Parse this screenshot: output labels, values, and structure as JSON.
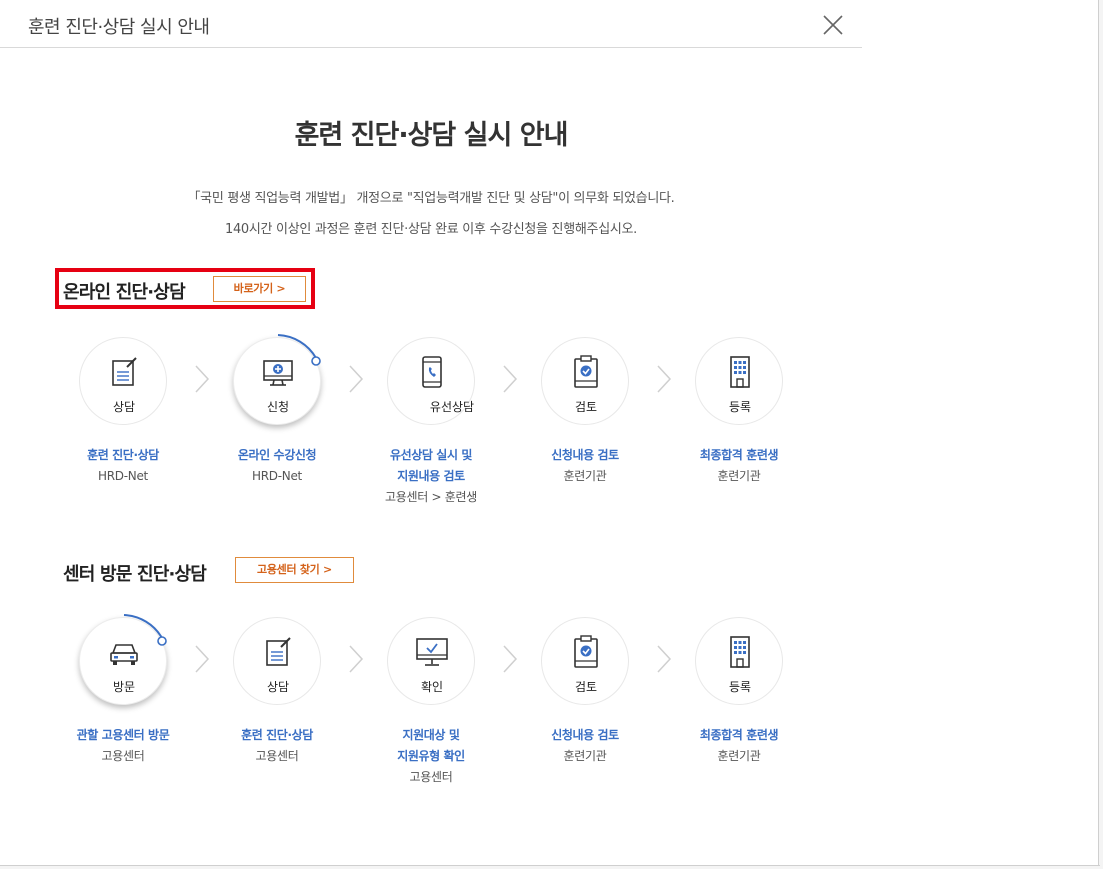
{
  "header": {
    "title": "훈련 진단·상담 실시 안내"
  },
  "main": {
    "title": "훈련 진단·상담 실시 안내",
    "desc1": "「국민 평생 직업능력 개발법」 개정으로 \"직업능력개발 진단 및 상담\"이 의무화 되었습니다.",
    "desc2": "140시간 이상인 과정은 훈련 진단·상담 완료 이후 수강신청을 진행해주십시오."
  },
  "online": {
    "title": "온라인 진단·상담",
    "button": "바로가기  >",
    "steps": [
      {
        "icon": "consult-icon",
        "label": "상담",
        "title1": "훈련 진단·상담",
        "title2": "",
        "sub": "HRD-Net",
        "active": false
      },
      {
        "icon": "monitor-plus-icon",
        "label": "신청",
        "title1": "온라인 수강신청",
        "title2": "",
        "sub": "HRD-Net",
        "active": true
      },
      {
        "icon": "phone-icon",
        "label": "유선상담",
        "title1": "유선상담 실시 및",
        "title2": "지원내용 검토",
        "sub": "고용센터 > 훈련생",
        "active": false
      },
      {
        "icon": "clipboard-check-icon",
        "label": "검토",
        "title1": "신청내용 검토",
        "title2": "",
        "sub": "훈련기관",
        "active": false
      },
      {
        "icon": "building-icon",
        "label": "등록",
        "title1": "최종합격 훈련생",
        "title2": "",
        "sub": "훈련기관",
        "active": false
      }
    ]
  },
  "center": {
    "title": "센터 방문 진단·상담",
    "button": "고용센터 찾기  >",
    "steps": [
      {
        "icon": "car-icon",
        "label": "방문",
        "title1": "관할 고용센터 방문",
        "title2": "",
        "sub": "고용센터",
        "active": true
      },
      {
        "icon": "consult-icon",
        "label": "상담",
        "title1": "훈련 진단·상담",
        "title2": "",
        "sub": "고용센터",
        "active": false
      },
      {
        "icon": "monitor-check-icon",
        "label": "확인",
        "title1": "지원대상 및",
        "title2": "지원유형 확인",
        "sub": "고용센터",
        "active": false
      },
      {
        "icon": "clipboard-check-icon",
        "label": "검토",
        "title1": "신청내용 검토",
        "title2": "",
        "sub": "훈련기관",
        "active": false
      },
      {
        "icon": "building-icon",
        "label": "등록",
        "title1": "최종합격 훈련생",
        "title2": "",
        "sub": "훈련기관",
        "active": false
      }
    ]
  },
  "colors": {
    "accent_blue": "#3a6fc4",
    "button_orange": "#d4621a",
    "highlight_red": "#e60012"
  }
}
